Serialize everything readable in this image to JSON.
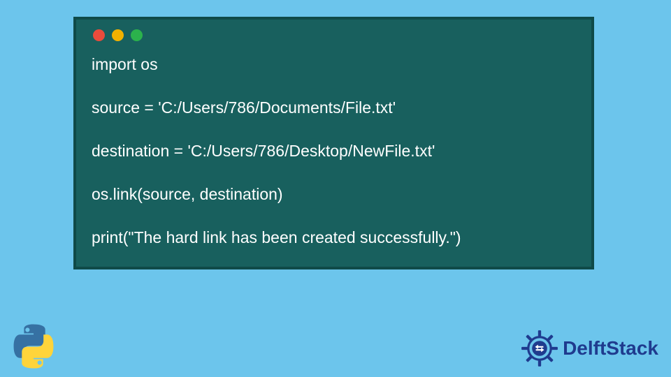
{
  "code": {
    "lines": [
      "import os",
      "",
      "source = 'C:/Users/786/Documents/File.txt'",
      "",
      "destination = 'C:/Users/786/Desktop/NewFile.txt'",
      "",
      "os.link(source, destination)",
      "",
      "print(\"The hard link has been created successfully.\")"
    ]
  },
  "brand": {
    "name": "DelftStack"
  }
}
